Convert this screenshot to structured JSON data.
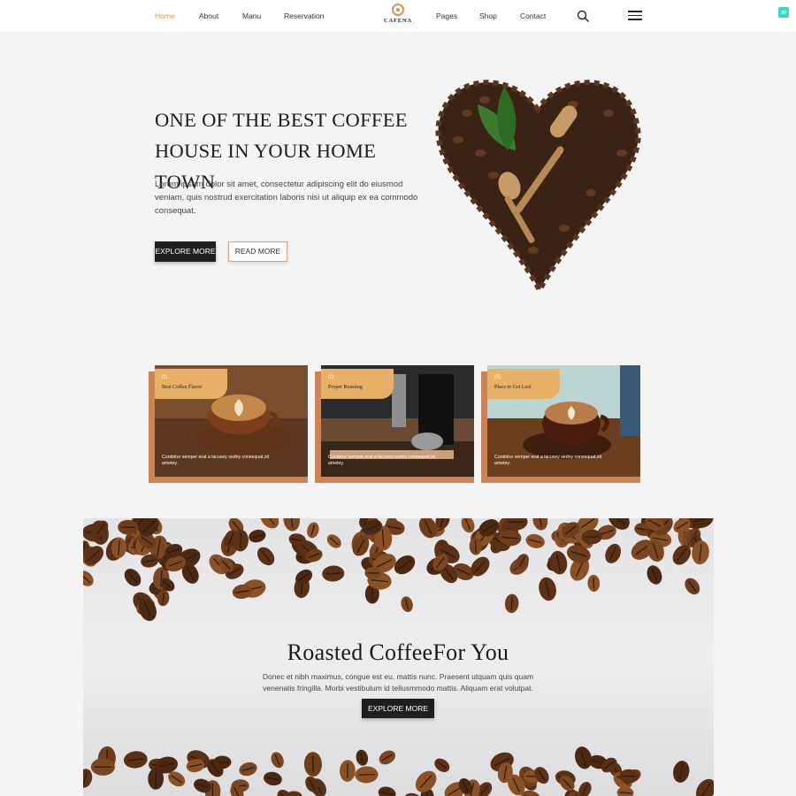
{
  "nav": {
    "items": [
      "Home",
      "About",
      "Manu",
      "Reservation",
      "Pages",
      "Shop",
      "Contact"
    ],
    "active": "Home",
    "logo_text": "CAFENA"
  },
  "hero": {
    "title_line1": "ONE OF THE BEST COFFEE",
    "title_line2": "HOUSE IN YOUR HOME TOWN",
    "text": "Lorem ipsum dolor sit amet, consectetur adipiscing elit do eiusmod veniam, quis nostrud exercitation laboris nisi ut aliquip ex ea commodo consequat.",
    "explore_label": "EXPLORE MORE",
    "read_label": "READ MORE"
  },
  "cards": [
    {
      "num": "01",
      "title": "Best Coffee Flavor",
      "desc": "Curabitur semper erat a lacusey sedny consequat,sit ametey."
    },
    {
      "num": "02",
      "title": "Proper Roasting",
      "desc": "Curabitur semper erat a lacusey sedny consequat,sit ametey."
    },
    {
      "num": "05",
      "title": "Place to Get Lost",
      "desc": "Curabitur semper erat a lacusey sedny consequat,sit ametey."
    }
  ],
  "banner": {
    "title": "Roasted CoffeeFor You",
    "text": "Donec et nibh maximus, congue est eu, mattis nunc. Praesent utquam quis quam venenatis fringilla. Morbi vestibulum id tellusmmodo mattis. Aliquam erat volutpat.",
    "button_label": "EXPLORE MORE"
  },
  "colors": {
    "accent": "#d4935a",
    "dark": "#1e1e1e",
    "card_tag": "#e8b066",
    "card_back": "#c98558"
  },
  "icons": [
    "search-icon",
    "hamburger-menu-icon",
    "cafena-logo-icon"
  ]
}
